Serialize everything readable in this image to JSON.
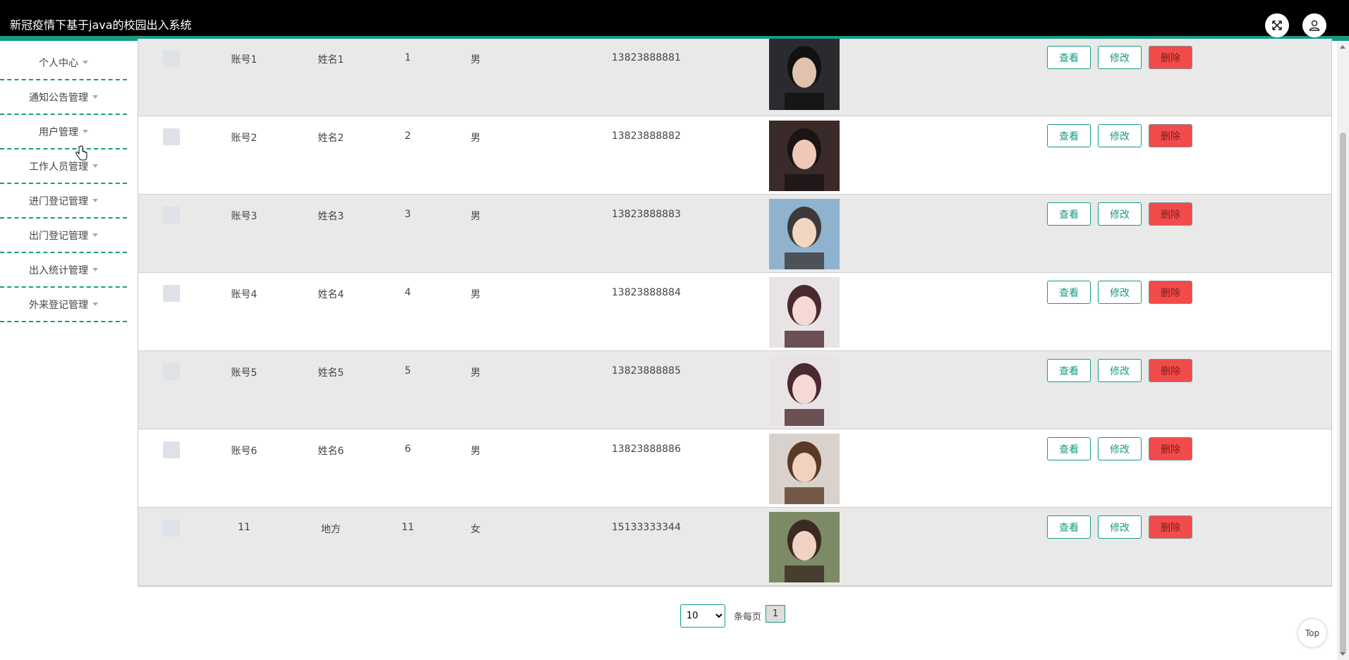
{
  "app": {
    "title": "新冠疫情下基于java的校园出入系统"
  },
  "header": {
    "fullscreen_icon": "expand-icon",
    "user_icon": "user-icon"
  },
  "sidebar": {
    "items": [
      {
        "label": "个人中心"
      },
      {
        "label": "通知公告管理"
      },
      {
        "label": "用户管理"
      },
      {
        "label": "工作人员管理"
      },
      {
        "label": "进门登记管理"
      },
      {
        "label": "出门登记管理"
      },
      {
        "label": "出入统计管理"
      },
      {
        "label": "外来登记管理"
      }
    ]
  },
  "table": {
    "rows": [
      {
        "account": "账号1",
        "name": "姓名1",
        "no": "1",
        "sex": "男",
        "phone": "13823888881",
        "photo": "photo-male-dark"
      },
      {
        "account": "账号2",
        "name": "姓名2",
        "no": "2",
        "sex": "男",
        "phone": "13823888882",
        "photo": "photo-female-hand"
      },
      {
        "account": "账号3",
        "name": "姓名3",
        "no": "3",
        "sex": "男",
        "phone": "13823888883",
        "photo": "photo-male-denim"
      },
      {
        "account": "账号4",
        "name": "姓名4",
        "no": "4",
        "sex": "男",
        "phone": "13823888884",
        "photo": "photo-female-lying"
      },
      {
        "account": "账号5",
        "name": "姓名5",
        "no": "5",
        "sex": "男",
        "phone": "13823888885",
        "photo": "photo-female-lying"
      },
      {
        "account": "账号6",
        "name": "姓名6",
        "no": "6",
        "sex": "男",
        "phone": "13823888886",
        "photo": "photo-female-long-hair"
      },
      {
        "account": "11",
        "name": "地方",
        "no": "11",
        "sex": "女",
        "phone": "15133333344",
        "photo": "photo-female-outdoor"
      }
    ],
    "actions": {
      "view": "查看",
      "edit": "修改",
      "delete": "删除"
    }
  },
  "pagination": {
    "page_size": "10",
    "page_size_options": [
      "10"
    ],
    "per_page_label": "条每页",
    "current_page": "1"
  },
  "back_to_top": "Top",
  "colors": {
    "accent": "#169b84",
    "danger": "#f24b4b",
    "header": "#000000"
  }
}
